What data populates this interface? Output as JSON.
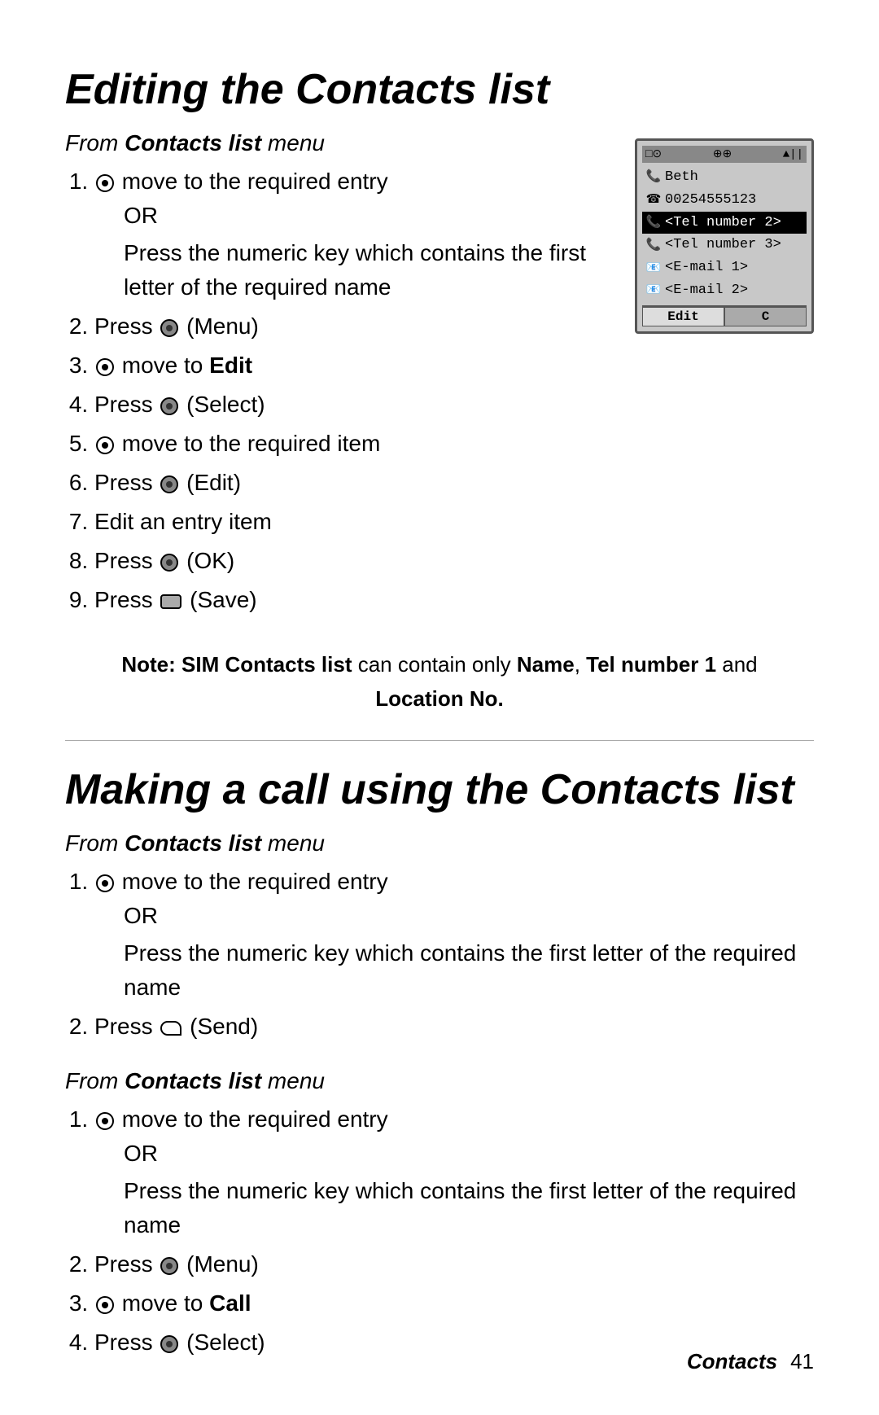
{
  "page": {
    "section1": {
      "title": "Editing the Contacts list",
      "subtitle_from": "From",
      "subtitle_bold": "Contacts list",
      "subtitle_rest": " menu",
      "steps": [
        {
          "id": 1,
          "has_joystick": true,
          "text": " move to the required entry",
          "sub": [
            {
              "type": "or",
              "text": "OR"
            },
            {
              "type": "indent",
              "text": "Press the numeric key which contains the first letter of the required name"
            }
          ]
        },
        {
          "id": 2,
          "has_button": true,
          "text": " (Menu)"
        },
        {
          "id": 3,
          "has_joystick": true,
          "text": " move to ",
          "bold_end": "Edit"
        },
        {
          "id": 4,
          "has_button": true,
          "text": " (Select)"
        },
        {
          "id": 5,
          "has_joystick": true,
          "text": " move to the required item"
        },
        {
          "id": 6,
          "has_button": true,
          "text": " (Edit)"
        },
        {
          "id": 7,
          "text": "Edit an entry item"
        },
        {
          "id": 8,
          "has_button": true,
          "text": " (OK)"
        },
        {
          "id": 9,
          "has_save": true,
          "text": " (Save)"
        }
      ],
      "note": {
        "prefix": "Note:",
        "bold1": "SIM Contacts list",
        "middle": " can contain only ",
        "bold2": "Name",
        "sep1": ", ",
        "bold3": "Tel number 1",
        "sep2": " and",
        "bold4": "Location No.",
        "last": ""
      },
      "phone_screen": {
        "status": [
          "□⊙",
          "⊕⊕",
          "▲||"
        ],
        "rows": [
          {
            "icon": "📞",
            "text": "Beth",
            "highlighted": false
          },
          {
            "icon": "☎",
            "text": "00254555123",
            "highlighted": false
          },
          {
            "icon": "📞",
            "text": "<Tel number 2>",
            "highlighted": true
          },
          {
            "icon": "📞",
            "text": "<Tel number 3>",
            "highlighted": false
          },
          {
            "icon": "📧",
            "text": "<E-mail 1>",
            "highlighted": false
          },
          {
            "icon": "📧",
            "text": "<E-mail 2>",
            "highlighted": false
          }
        ],
        "soft_left": "Edit",
        "soft_right": "C"
      }
    },
    "section2": {
      "title": "Making a call using the Contacts list",
      "subtitle_from": "From",
      "subtitle_bold": "Contacts list",
      "subtitle_rest": " menu",
      "steps_a": [
        {
          "id": 1,
          "has_joystick": true,
          "text": " move to the required entry",
          "sub": [
            {
              "type": "or",
              "text": "OR"
            },
            {
              "type": "indent",
              "text": "Press the numeric key which contains the first letter of the required name"
            }
          ]
        },
        {
          "id": 2,
          "has_send": true,
          "text": " (Send)"
        }
      ],
      "subtitle2_from": "From",
      "subtitle2_bold": "Contacts list",
      "subtitle2_rest": " menu",
      "steps_b": [
        {
          "id": 1,
          "has_joystick": true,
          "text": " move to the required entry",
          "sub": [
            {
              "type": "or",
              "text": "OR"
            },
            {
              "type": "indent",
              "text": "Press the numeric key which contains the first letter of the required name"
            }
          ]
        },
        {
          "id": 2,
          "has_button": true,
          "text": " (Menu)"
        },
        {
          "id": 3,
          "has_joystick": true,
          "text": " move to ",
          "bold_end": "Call"
        },
        {
          "id": 4,
          "has_button": true,
          "text": " (Select)"
        }
      ]
    },
    "footer": {
      "label": "Contacts",
      "page_number": "41"
    }
  }
}
